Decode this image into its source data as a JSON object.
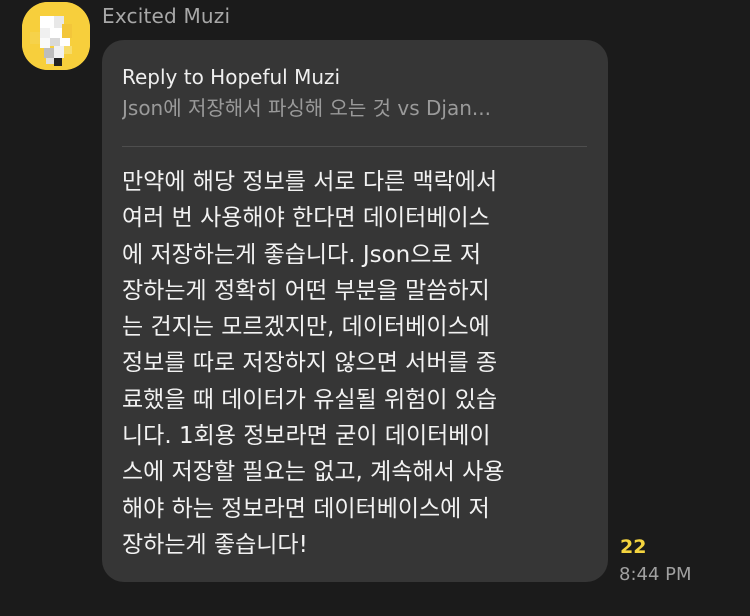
{
  "sender": {
    "name": "Excited Muzi",
    "avatar_icon": "muzi-avatar-icon",
    "avatar_color": "#f7cf3c"
  },
  "reply": {
    "title": "Reply to Hopeful Muzi",
    "snippet": "Json에 저장해서 파싱해 오는 것 vs Djan..."
  },
  "message": {
    "lines": [
      "만약에 해당 정보를 서로 다른 맥락에서",
      "여러 번 사용해야 한다면 데이터베이스",
      "에 저장하는게 좋습니다. Json으로 저",
      "장하는게 정확히 어떤 부분을 말씀하지",
      "는 건지는 모르겠지만, 데이터베이스에",
      "정보를 따로 저장하지 않으면 서버를 종",
      "료했을 때 데이터가 유실될 위험이 있습",
      "니다. 1회용 정보라면 굳이 데이터베이",
      "스에 저장할 필요는 없고, 계속해서 사용",
      "해야 하는 정보라면 데이터베이스에 저",
      "장하는게 좋습니다!"
    ]
  },
  "meta": {
    "unread_count": "22",
    "time": "8:44 PM"
  },
  "colors": {
    "background": "#1b1b1b",
    "bubble": "#363636",
    "unread": "#f4d43f"
  }
}
